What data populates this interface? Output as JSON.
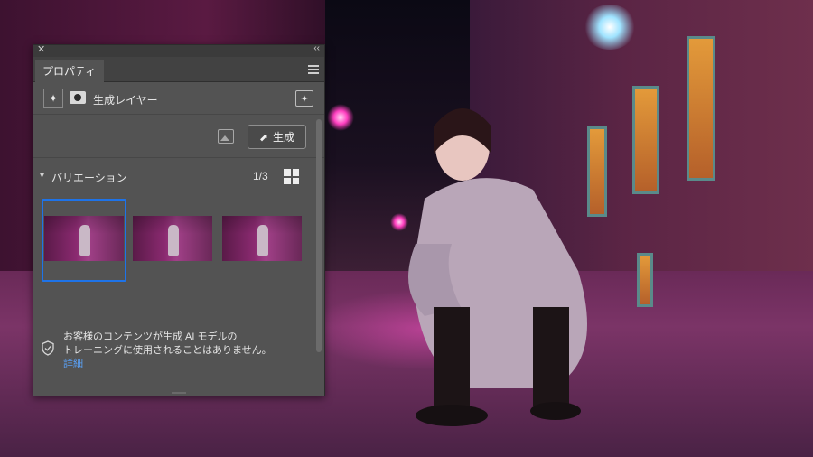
{
  "panel": {
    "close_glyph": "✕",
    "collapse_glyph": "‹‹",
    "tab_label": "プロパティ",
    "layer": {
      "label": "生成レイヤー"
    },
    "generate_button_label": "生成",
    "variations": {
      "title": "バリエーション",
      "count": "1/3",
      "selected_index": 0
    },
    "notice": {
      "line1": "お客様のコンテンツが生成 AI モデルの",
      "line2": "トレーニングに使用されることはありません。",
      "link": "詳細"
    }
  },
  "colors": {
    "panel_bg": "#535353",
    "selection_blue": "#1e73e8",
    "link_blue": "#5aa0f5"
  },
  "icons": [
    "close-icon",
    "collapse-icon",
    "panel-menu-icon",
    "sparkle-icon",
    "mask-icon",
    "generate-layer-icon",
    "reference-image-icon",
    "generate-icon",
    "chevron-down-icon",
    "grid-view-icon",
    "shield-icon"
  ]
}
